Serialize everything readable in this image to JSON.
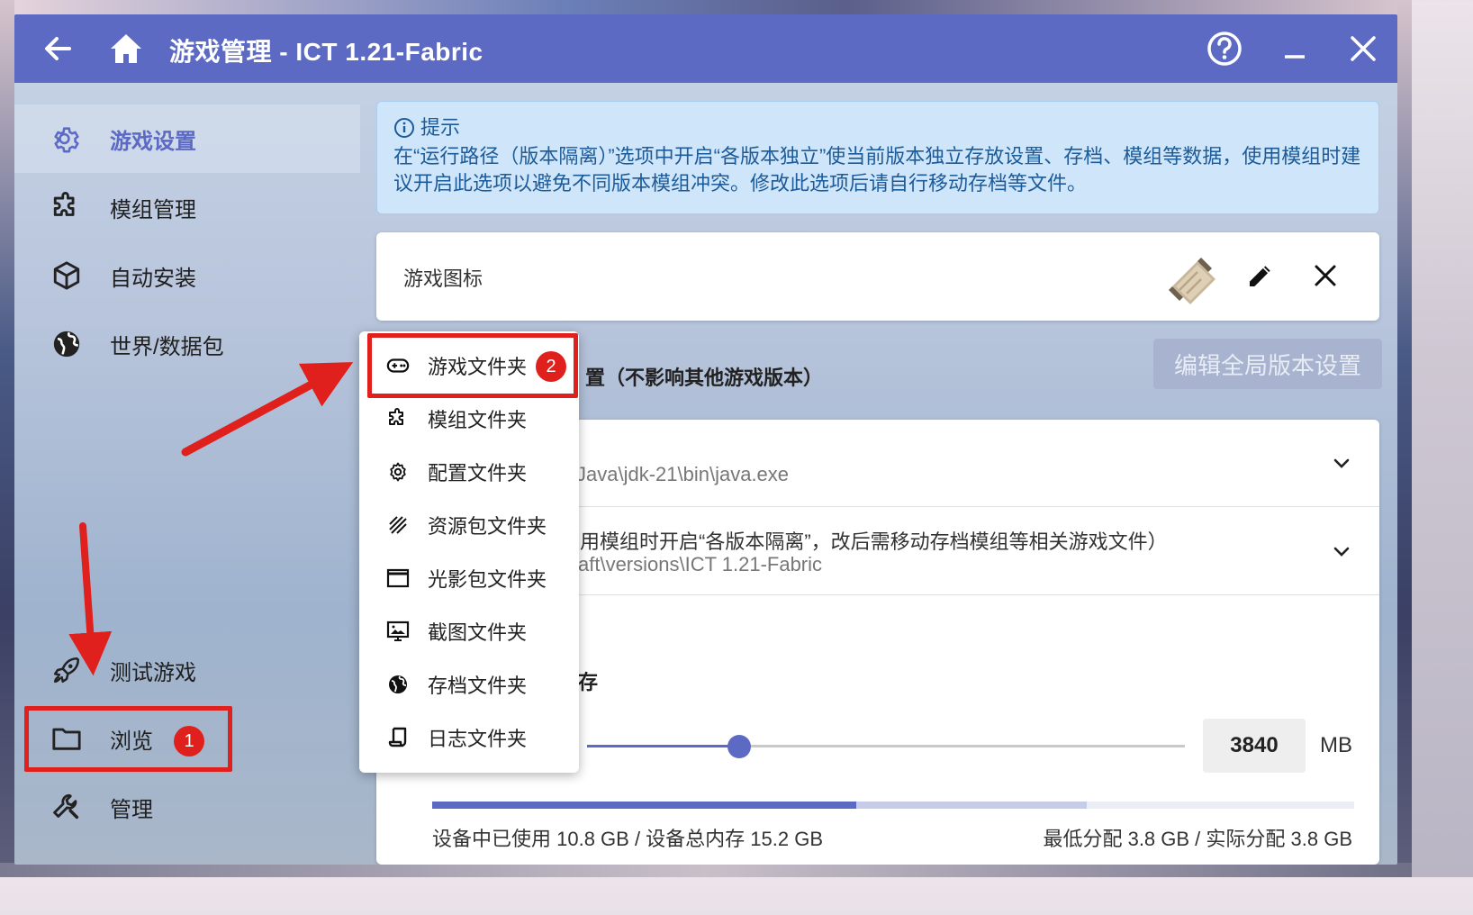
{
  "window": {
    "title": "游戏管理 - ICT 1.21-Fabric",
    "accent_color": "#5c6ac4",
    "icons": [
      "back-arrow-icon",
      "home-icon",
      "help-icon",
      "minimize-icon",
      "close-icon"
    ]
  },
  "sidebar": {
    "items": [
      {
        "label": "游戏设置",
        "icon": "gear-icon",
        "active": true
      },
      {
        "label": "模组管理",
        "icon": "puzzle-icon"
      },
      {
        "label": "自动安装",
        "icon": "cube-icon"
      },
      {
        "label": "世界/数据包",
        "icon": "globe-icon"
      }
    ],
    "bottom_items": [
      {
        "label": "测试游戏",
        "icon": "rocket-icon"
      },
      {
        "label": "浏览",
        "icon": "folder-icon",
        "badge": "1"
      },
      {
        "label": "管理",
        "icon": "wrench-icon"
      }
    ]
  },
  "tip": {
    "title": "提示",
    "text": "在“运行路径（版本隔离）”选项中开启“各版本独立”使当前版本独立存放设置、存档、模组等数据，使用模组时建议开启此选项以避免不同版本模组冲突。修改此选项后请自行移动存档等文件。"
  },
  "game_icon": {
    "label": "游戏图标",
    "icons": [
      "scroll-icon",
      "pencil-icon",
      "close-icon"
    ]
  },
  "version_settings": {
    "title_visible": "置（不影响其他游戏版本）",
    "global_button": "编辑全局版本设置"
  },
  "java": {
    "path_visible": "Java\\jdk-21\\bin\\java.exe"
  },
  "run_dir": {
    "text_visible": "用模组时开启“各版本隔离”，改后需移动存档模组等相关游戏文件）",
    "path_visible": "aft\\versions\\ICT 1.21-Fabric"
  },
  "memory": {
    "title_visible": "存",
    "value": "3840",
    "unit": "MB",
    "slider_fraction": 0.25,
    "used_text": "设备中已使用 10.8 GB / 设备总内存 15.2 GB",
    "alloc_text": "最低分配 3.8 GB / 实际分配 3.8 GB",
    "used_fraction": 0.71,
    "alloc_fraction": 0.25
  },
  "browse_menu": {
    "items": [
      {
        "label": "游戏文件夹",
        "icon": "gamepad-icon",
        "badge": "2"
      },
      {
        "label": "模组文件夹",
        "icon": "puzzle-icon"
      },
      {
        "label": "配置文件夹",
        "icon": "gear-icon"
      },
      {
        "label": "资源包文件夹",
        "icon": "texture-icon"
      },
      {
        "label": "光影包文件夹",
        "icon": "window-icon"
      },
      {
        "label": "截图文件夹",
        "icon": "monitor-image-icon"
      },
      {
        "label": "存档文件夹",
        "icon": "globe-icon"
      },
      {
        "label": "日志文件夹",
        "icon": "log-icon"
      }
    ]
  },
  "annotations": {
    "highlight_color": "#e0201c"
  }
}
